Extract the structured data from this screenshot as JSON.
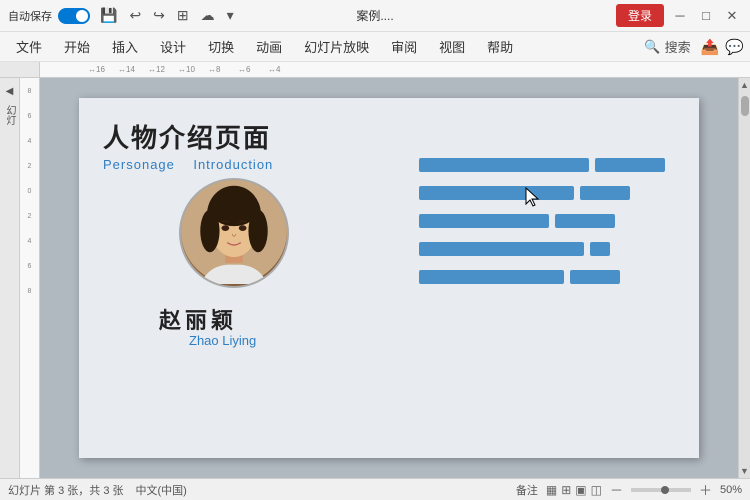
{
  "titlebar": {
    "autosave": "自动保存",
    "toggle_state": "on",
    "filename": "案例....",
    "login_label": "登录",
    "window_controls": [
      "─",
      "□",
      "✕"
    ]
  },
  "menubar": {
    "items": [
      "文件",
      "开始",
      "插入",
      "设计",
      "切换",
      "动画",
      "幻灯片放映",
      "审阅",
      "视图",
      "帮助"
    ],
    "search_label": "搜索"
  },
  "slide": {
    "title_zh": "人物介绍页面",
    "title_en_1": "Personage",
    "title_en_2": "Introduction",
    "name_zh": "赵丽颖",
    "name_en": "Zhao Liying"
  },
  "statusbar": {
    "slide_info": "幻灯片 第 3 张，共 3 张",
    "language": "中文(中国)",
    "notes": "备注",
    "zoom": "50%"
  },
  "bars": [
    {
      "long": 170,
      "short": 70
    },
    {
      "long": 155,
      "short": 50
    },
    {
      "long": 120,
      "short": 55
    },
    {
      "long": 160,
      "short": 20
    },
    {
      "long": 140,
      "short": 50
    }
  ]
}
